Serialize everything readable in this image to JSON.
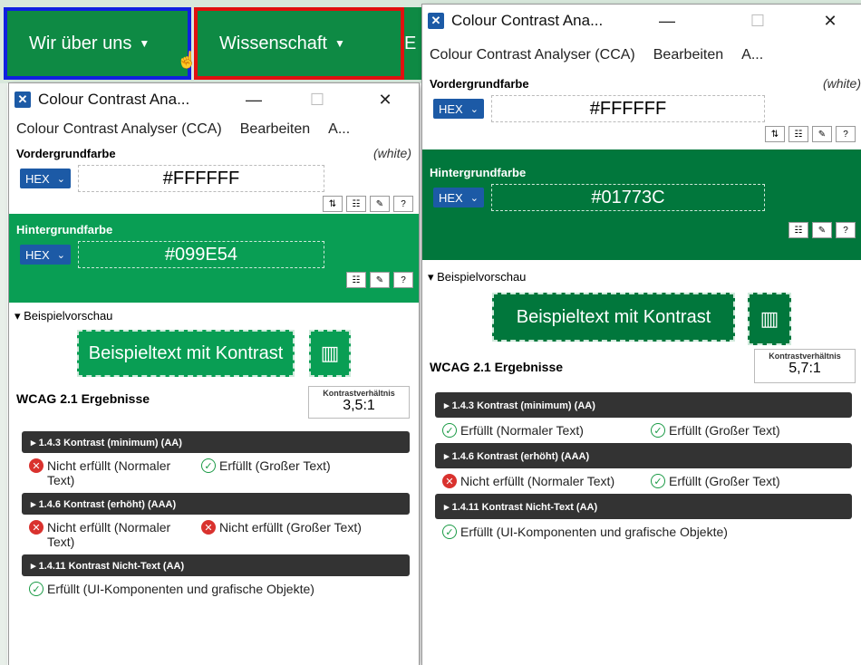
{
  "website": {
    "nav": [
      {
        "label": "Wir über uns"
      },
      {
        "label": "Wissenschaft"
      },
      {
        "label": "E"
      }
    ]
  },
  "colors": {
    "bg_left": "#099E54",
    "bg_right": "#01773C",
    "highlight_blue": "#1020e0",
    "highlight_red": "#e01010"
  },
  "left_window": {
    "title": "Colour Contrast Ana...",
    "menu": [
      "Colour Contrast Analyser (CCA)",
      "Bearbeiten",
      "A..."
    ],
    "fg_label": "Vordergrundfarbe",
    "fg_note": "(white)",
    "fg_format": "HEX",
    "fg_value": "#FFFFFF",
    "bg_label": "Hintergrundfarbe",
    "bg_format": "HEX",
    "bg_value": "#099E54",
    "preview_label": "▾ Beispielvorschau",
    "preview_text": "Beispieltext mit Kontrast",
    "wcag_title": "WCAG 2.1 Ergebnisse",
    "ratio_label": "Kontrastverhältnis",
    "ratio_value": "3,5:1",
    "criteria": [
      {
        "label": "▸ 1.4.3 Kontrast (minimum) (AA)",
        "r1": "Nicht erfüllt (Normaler Text)",
        "r2": "Erfüllt (Großer Text)"
      },
      {
        "label": "▸ 1.4.6 Kontrast (erhöht) (AAA)",
        "r1": "Nicht erfüllt (Normaler Text)",
        "r2": "Nicht erfüllt (Großer Text)"
      },
      {
        "label": "▸ 1.4.11 Kontrast Nicht-Text (AA)",
        "r1": "Erfüllt (UI-Komponenten und grafische Objekte)"
      }
    ]
  },
  "right_window": {
    "title": "Colour Contrast Ana...",
    "menu": [
      "Colour Contrast Analyser (CCA)",
      "Bearbeiten",
      "A..."
    ],
    "fg_label": "Vordergrundfarbe",
    "fg_note": "(white)",
    "fg_format": "HEX",
    "fg_value": "#FFFFFF",
    "bg_label": "Hintergrundfarbe",
    "bg_format": "HEX",
    "bg_value": "#01773C",
    "preview_label": "▾ Beispielvorschau",
    "preview_text": "Beispieltext mit Kontrast",
    "wcag_title": "WCAG 2.1 Ergebnisse",
    "ratio_label": "Kontrastverhältnis",
    "ratio_value": "5,7:1",
    "criteria": [
      {
        "label": "▸ 1.4.3 Kontrast (minimum) (AA)",
        "r1": "Erfüllt (Normaler Text)",
        "r2": "Erfüllt (Großer Text)"
      },
      {
        "label": "▸ 1.4.6 Kontrast (erhöht) (AAA)",
        "r1": "Nicht erfüllt (Normaler Text)",
        "r2": "Erfüllt (Großer Text)"
      },
      {
        "label": "▸ 1.4.11 Kontrast Nicht-Text (AA)",
        "r1": "Erfüllt (UI-Komponenten und grafische Objekte)"
      }
    ]
  }
}
